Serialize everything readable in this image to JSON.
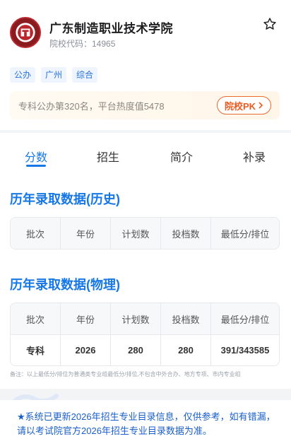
{
  "school": {
    "name": "广东制造职业技术学院",
    "code_label": "院校代码：14965"
  },
  "icons": {
    "star": "star-outline-icon",
    "chevron": "chevron-right-icon",
    "logo": "school-emblem"
  },
  "tags": [
    "公办",
    "广州",
    "综合"
  ],
  "rank": {
    "text": "专科公办第320名，平台热度值5478",
    "pk_label": "院校PK"
  },
  "tabs": [
    {
      "label": "分数",
      "active": true
    },
    {
      "label": "招生",
      "active": false
    },
    {
      "label": "简介",
      "active": false
    },
    {
      "label": "补录",
      "active": false
    }
  ],
  "sections": {
    "history": {
      "title": "历年录取数据(历史)",
      "headers": [
        "批次",
        "年份",
        "计划数",
        "投档数",
        "最低分/排位"
      ],
      "rows": []
    },
    "physics": {
      "title": "历年录取数据(物理)",
      "headers": [
        "批次",
        "年份",
        "计划数",
        "投档数",
        "最低分/排位"
      ],
      "rows": [
        [
          "专科",
          "2026",
          "280",
          "280",
          "391/343585"
        ]
      ]
    }
  },
  "note": "备注：以上最低分/排位为普通类专业组最低分/排位,不包含中外合办、地方专项、市内专业组",
  "notice": "★系统已更新2026年招生专业目录信息，仅供参考，如有错漏，请以考试院官方2026年招生专业目录数据为准。",
  "colors": {
    "accent": "#1677e5",
    "pk": "#ec5a22",
    "logo": "#8a1b1f"
  }
}
